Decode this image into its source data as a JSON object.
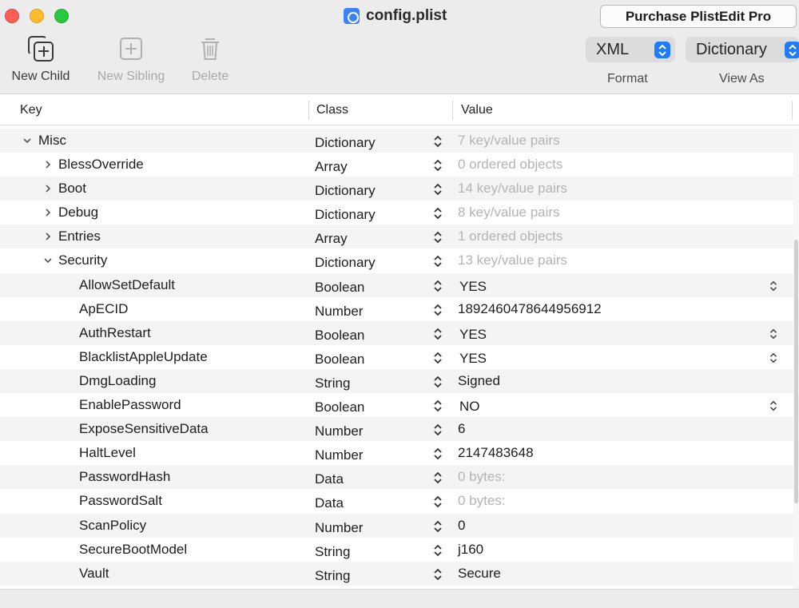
{
  "window": {
    "title": "config.plist",
    "purchase_label": "Purchase PlistEdit Pro"
  },
  "toolbar": {
    "new_child": "New Child",
    "new_sibling": "New Sibling",
    "delete": "Delete",
    "format_value": "XML",
    "format_label": "Format",
    "view_as_value": "Dictionary",
    "view_as_label": "View As"
  },
  "columns": {
    "key": "Key",
    "class": "Class",
    "value": "Value"
  },
  "rows": [
    {
      "key": "Misc",
      "class": "Dictionary",
      "value": "7 key/value pairs",
      "indent": 0,
      "expander": "open"
    },
    {
      "key": "BlessOverride",
      "class": "Array",
      "value": "0 ordered objects",
      "indent": 1,
      "expander": "closed"
    },
    {
      "key": "Boot",
      "class": "Dictionary",
      "value": "14 key/value pairs",
      "indent": 1,
      "expander": "closed"
    },
    {
      "key": "Debug",
      "class": "Dictionary",
      "value": "8 key/value pairs",
      "indent": 1,
      "expander": "closed"
    },
    {
      "key": "Entries",
      "class": "Array",
      "value": "1 ordered objects",
      "indent": 1,
      "expander": "closed"
    },
    {
      "key": "Security",
      "class": "Dictionary",
      "value": "13 key/value pairs",
      "indent": 1,
      "expander": "open"
    },
    {
      "key": "AllowSetDefault",
      "class": "Boolean",
      "value": "YES",
      "indent": 2,
      "expander": "none"
    },
    {
      "key": "ApECID",
      "class": "Number",
      "value": "1892460478644956912",
      "indent": 2,
      "expander": "none"
    },
    {
      "key": "AuthRestart",
      "class": "Boolean",
      "value": "YES",
      "indent": 2,
      "expander": "none"
    },
    {
      "key": "BlacklistAppleUpdate",
      "class": "Boolean",
      "value": "YES",
      "indent": 2,
      "expander": "none"
    },
    {
      "key": "DmgLoading",
      "class": "String",
      "value": "Signed",
      "indent": 2,
      "expander": "none"
    },
    {
      "key": "EnablePassword",
      "class": "Boolean",
      "value": "NO",
      "indent": 2,
      "expander": "none"
    },
    {
      "key": "ExposeSensitiveData",
      "class": "Number",
      "value": "6",
      "indent": 2,
      "expander": "none"
    },
    {
      "key": "HaltLevel",
      "class": "Number",
      "value": "2147483648",
      "indent": 2,
      "expander": "none"
    },
    {
      "key": "PasswordHash",
      "class": "Data",
      "value": "0 bytes:",
      "indent": 2,
      "expander": "none"
    },
    {
      "key": "PasswordSalt",
      "class": "Data",
      "value": "0 bytes:",
      "indent": 2,
      "expander": "none"
    },
    {
      "key": "ScanPolicy",
      "class": "Number",
      "value": "0",
      "indent": 2,
      "expander": "none"
    },
    {
      "key": "SecureBootModel",
      "class": "String",
      "value": "j160",
      "indent": 2,
      "expander": "none"
    },
    {
      "key": "Vault",
      "class": "String",
      "value": "Secure",
      "indent": 2,
      "expander": "none"
    }
  ],
  "colors": {
    "accent": "#1f7aff",
    "toolbar_bg": "#ececec",
    "row_alt": "#f4f4f4",
    "muted_text": "#b4b4b4"
  }
}
